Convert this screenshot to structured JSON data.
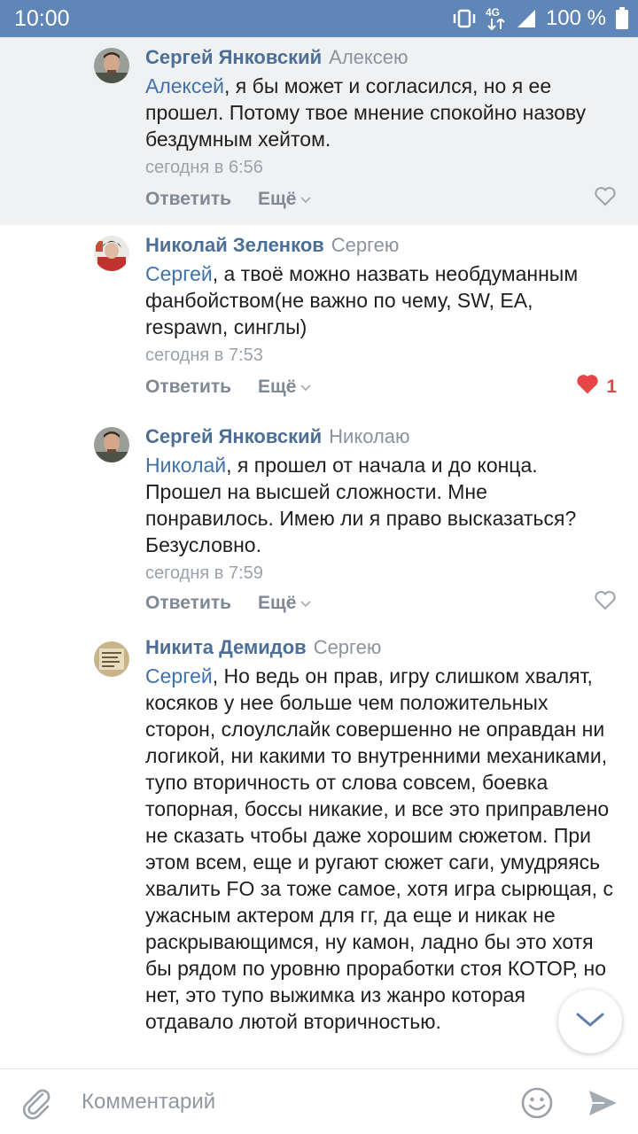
{
  "status_bar": {
    "time": "10:00",
    "network": "4G",
    "battery": "100 %"
  },
  "comments": [
    {
      "author": "Сергей Янковский",
      "reply_to": "Алексею",
      "mention": "Алексей",
      "text": ", я бы может и согласился, но я ее прошел. Потому твое мнение спокойно назову бездумным хейтом.",
      "time": "сегодня в 6:56",
      "reply_label": "Ответить",
      "more_label": "Ещё",
      "likes": "",
      "liked": false
    },
    {
      "author": "Николай Зеленков",
      "reply_to": "Сергею",
      "mention": "Сергей",
      "text": ", а твоё можно назвать необдуманным фанбойством(не важно по чему, SW, EA, respawn, синглы)",
      "time": "сегодня в 7:53",
      "reply_label": "Ответить",
      "more_label": "Ещё",
      "likes": "1",
      "liked": true
    },
    {
      "author": "Сергей Янковский",
      "reply_to": "Николаю",
      "mention": "Николай",
      "text": ", я прошел от начала и до конца. Прошел на высшей сложности. Мне понравилось. Имею ли я право высказаться? Безусловно.",
      "time": "сегодня в 7:59",
      "reply_label": "Ответить",
      "more_label": "Ещё",
      "likes": "",
      "liked": false
    },
    {
      "author": "Никита Демидов",
      "reply_to": "Сергею",
      "mention": "Сергей",
      "text": ", Но ведь он прав, игру слишком хвалят, косяков у нее больше чем положительных сторон, слоулслайк совершенно не оправдан ни логикой, ни какими то внутренними механиками, тупо вторичность от слова совсем, боевка топорная, боссы никакие, и все это приправлено не сказать чтобы даже хорошим сюжетом. При этом всем, еще и ругают сюжет саги, умудряясь хвалить FO за тоже самое, хотя игра сырющая, с ужасным актером для гг, да еще и никак не раскрывающимся, ну камон, ладно бы это хотя бы рядом по уровню проработки стоя КОТОР, но нет, это тупо выжимка из жанро которая отдавало лютой вторичностью."
    }
  ],
  "compose": {
    "placeholder": "Комментарий"
  },
  "icons": {
    "vibrate": "vibrate-icon",
    "signal": "signal-icon",
    "attach": "paperclip-icon",
    "emoji": "smiley-icon",
    "send": "send-icon",
    "scroll": "chevron-down-icon",
    "like": "heart-icon"
  },
  "colors": {
    "status_bar": "#5f86b6",
    "author": "#4c6f97",
    "mention": "#3f72ad",
    "liked_heart": "#e64646"
  }
}
